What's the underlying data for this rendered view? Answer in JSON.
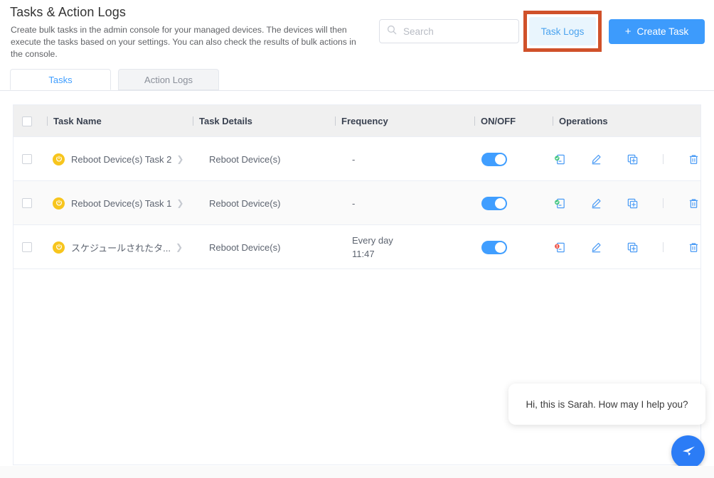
{
  "header": {
    "title": "Tasks & Action Logs",
    "description": "Create bulk tasks in the admin console for your managed devices. The devices will then execute the tasks based on your settings. You can also check the results of bulk actions in the console.",
    "search": {
      "placeholder": "Search",
      "value": "",
      "icon": "search-icon"
    },
    "task_logs_label": "Task Logs",
    "create_task_label": "Create Task",
    "create_task_icon": "plus-icon",
    "highlight_color": "#d0512a",
    "accent_color": "#3d9bfc"
  },
  "tabs": [
    {
      "label": "Tasks",
      "active": true
    },
    {
      "label": "Action Logs",
      "active": false
    }
  ],
  "table": {
    "columns": [
      "Task Name",
      "Task Details",
      "Frequency",
      "ON/OFF",
      "Operations"
    ],
    "select_all_checked": false,
    "rows": [
      {
        "checked": false,
        "icon": "power-icon",
        "name": "Reboot Device(s) Task 2",
        "details": "Reboot Device(s)",
        "frequency": "-",
        "frequency_time": "",
        "enabled": true,
        "report_status": "success",
        "ops": [
          "report-icon",
          "edit-icon",
          "duplicate-icon",
          "delete-icon"
        ]
      },
      {
        "checked": false,
        "icon": "power-icon",
        "name": "Reboot Device(s) Task 1",
        "details": "Reboot Device(s)",
        "frequency": "-",
        "frequency_time": "",
        "enabled": true,
        "report_status": "success",
        "ops": [
          "report-icon",
          "edit-icon",
          "duplicate-icon",
          "delete-icon"
        ]
      },
      {
        "checked": false,
        "icon": "power-icon",
        "name": "スケジュールされたタ...",
        "details": "Reboot Device(s)",
        "frequency": "Every day",
        "frequency_time": "11:47",
        "enabled": true,
        "report_status": "error",
        "ops": [
          "report-icon",
          "edit-icon",
          "duplicate-icon",
          "delete-icon"
        ]
      }
    ]
  },
  "chat": {
    "message": "Hi, this is Sarah. How may I help you?",
    "fab_icon": "send-icon",
    "fab_color": "#2b7cf6"
  }
}
